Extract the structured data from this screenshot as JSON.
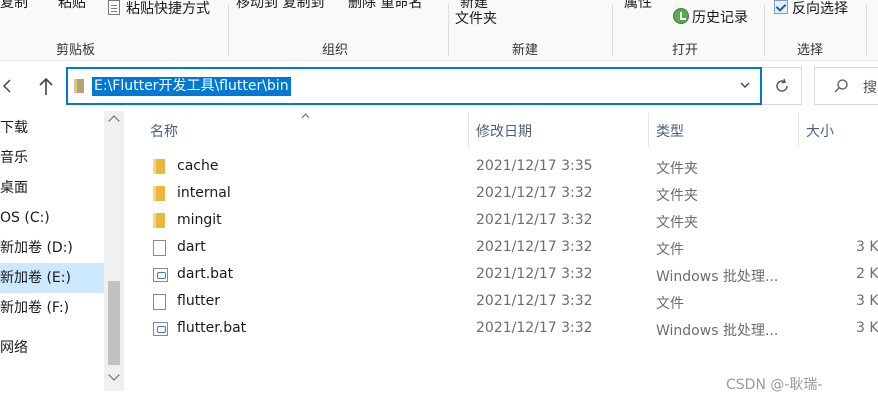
{
  "ribbon": {
    "clipped_top": {
      "copy_path": "复制",
      "paste": "粘贴",
      "move_copy_to": "移动到 复制到",
      "delete_rename": "删除 重命名",
      "new_label": "新建"
    },
    "paste_shortcut": "粘贴快捷方式",
    "new_folder": "文件夹",
    "open_clipped": "属性",
    "history": "历史记录",
    "invert_selection": "反向选择",
    "groups": {
      "clipboard": "剪贴板",
      "organize": "组织",
      "new": "新建",
      "open": "打开",
      "select": "选择"
    }
  },
  "address": {
    "path": "E:\\Flutter开发工具\\flutter\\bin",
    "search_placeholder": "搜"
  },
  "sidebar": {
    "items": [
      {
        "label": "下载",
        "selected": false
      },
      {
        "label": "音乐",
        "selected": false
      },
      {
        "label": "桌面",
        "selected": false
      },
      {
        "label": "OS (C:)",
        "selected": false
      },
      {
        "label": "新加卷 (D:)",
        "selected": false
      },
      {
        "label": "新加卷 (E:)",
        "selected": true
      },
      {
        "label": "新加卷 (F:)",
        "selected": false
      },
      {
        "label": "网络",
        "selected": false
      }
    ]
  },
  "filelist": {
    "columns": {
      "name": "名称",
      "date": "修改日期",
      "type": "类型",
      "size": "大小"
    },
    "sort": {
      "column": "name",
      "direction": "ascending"
    },
    "rows": [
      {
        "name": "cache",
        "date": "2021/12/17 3:35",
        "type": "文件夹",
        "size": "",
        "icon": "folder-icon"
      },
      {
        "name": "internal",
        "date": "2021/12/17 3:32",
        "type": "文件夹",
        "size": "",
        "icon": "folder-icon"
      },
      {
        "name": "mingit",
        "date": "2021/12/17 3:32",
        "type": "文件夹",
        "size": "",
        "icon": "folder-icon"
      },
      {
        "name": "dart",
        "date": "2021/12/17 3:32",
        "type": "文件",
        "size": "3 K",
        "icon": "file-icon"
      },
      {
        "name": "dart.bat",
        "date": "2021/12/17 3:32",
        "type": "Windows 批处理...",
        "size": "2 K",
        "icon": "batch-file-icon"
      },
      {
        "name": "flutter",
        "date": "2021/12/17 3:32",
        "type": "文件",
        "size": "3 K",
        "icon": "file-icon"
      },
      {
        "name": "flutter.bat",
        "date": "2021/12/17 3:32",
        "type": "Windows 批处理...",
        "size": "3 K",
        "icon": "batch-file-icon"
      }
    ]
  },
  "watermark": "CSDN @-耿瑞-",
  "colors": {
    "accent": "#0078d7",
    "selected_bg": "#cce8ff",
    "folder": "#e8b83e"
  }
}
